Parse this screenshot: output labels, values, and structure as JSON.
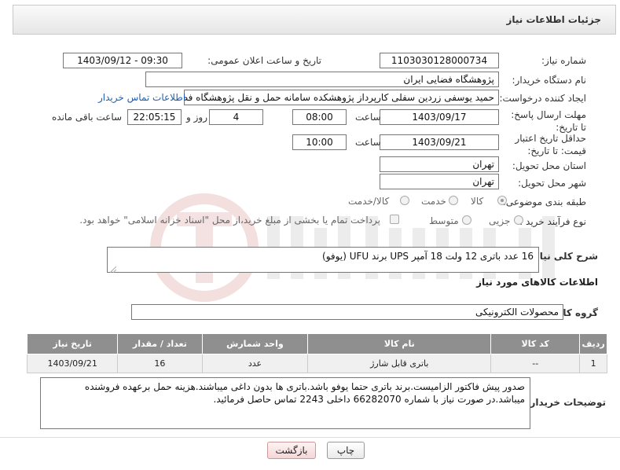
{
  "header": {
    "title": "جزئیات اطلاعات نیاز"
  },
  "fields": {
    "need_number_label": "شماره نیاز:",
    "need_number": "1103030128000734",
    "announce_label": "تاریخ و ساعت اعلان عمومی:",
    "announce_value": "1403/09/12 - 09:30",
    "buyer_org_label": "نام دستگاه خریدار:",
    "buyer_org": "پژوهشگاه فضایی ایران",
    "creator_label": "ایجاد کننده درخواست:",
    "creator": "حمید یوسفی زردین سفلی کارپرداز پژوهشکده سامانه حمل و نقل پژوهشگاه فضایی",
    "contact_link": "اطلاعات تماس خریدار",
    "reply_deadline_label": "مهلت ارسال پاسخ: تا تاریخ:",
    "reply_date": "1403/09/17",
    "time_label": "ساعت",
    "reply_time": "08:00",
    "days_value": "4",
    "days_label": "روز و",
    "remaining_time": "22:05:15",
    "remaining_label": "ساعت باقی مانده",
    "validity_label": "حداقل تاریخ اعتبار قیمت: تا تاریخ:",
    "validity_date": "1403/09/21",
    "validity_time": "10:00",
    "province_label": "استان محل تحویل:",
    "province": "تهران",
    "city_label": "شهر محل تحویل:",
    "city": "تهران",
    "category_label": "طبقه بندی موضوعی:",
    "category_options": [
      "کالا",
      "خدمت",
      "کالا/خدمت"
    ],
    "process_label": "نوع فرآیند خرید :",
    "process_options": [
      "جزیی",
      "متوسط"
    ],
    "payment_note": "پرداخت تمام یا بخشی از مبلغ خرید،از محل \"اسناد خزانه اسلامی\" خواهد بود."
  },
  "description": {
    "label": "شرح کلی نیاز:",
    "text": "16 عدد باتری 12 ولت 18 آمپر UPS برند UFU (یوفو)"
  },
  "goods_info": {
    "title": "اطلاعات کالاهای مورد نیاز",
    "group_label": "گروه کالا:",
    "group_value": "محصولات الکترونیکی"
  },
  "table": {
    "headers": [
      "ردیف",
      "کد کالا",
      "نام کالا",
      "واحد شمارش",
      "تعداد / مقدار",
      "تاریخ نیاز"
    ],
    "rows": [
      [
        "1",
        "--",
        "باتری قابل شارژ",
        "عدد",
        "16",
        "1403/09/21"
      ]
    ]
  },
  "buyer_notes": {
    "label": "توضیحات خریدار:",
    "text": "صدور پیش فاکتور الزامیست.برند باتری حتما یوفو باشد.باتری ها بدون داغی میباشند.هزینه حمل برعهده فروشنده میباشد.در صورت نیاز با شماره 66282070 داخلی 2243 تماس حاصل فرمائید."
  },
  "buttons": {
    "print": "چاپ",
    "back": "بازگشت"
  },
  "colors": {
    "table_header": "#8f8f8f",
    "link": "#1f5fb4",
    "back_button": "#f3d6d6"
  }
}
